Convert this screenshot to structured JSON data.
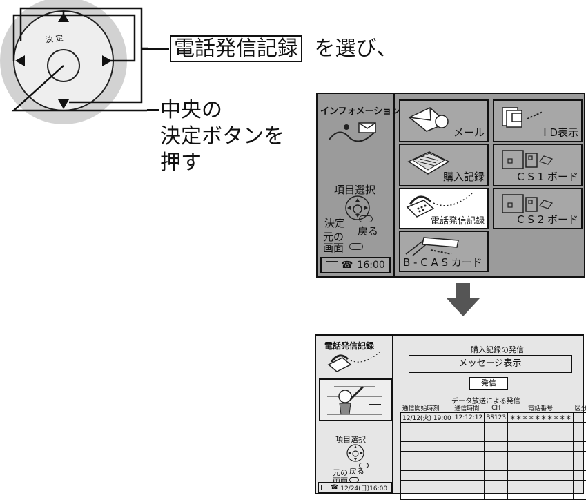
{
  "instruction": {
    "select_item": "電話発信記録",
    "select_suffix": "を選び、",
    "center_line1": "中央の",
    "center_line2": "決定ボタンを",
    "center_line3": "押す",
    "dpad_center_label": "決 定"
  },
  "menu_screen": {
    "title": "インフォメーション",
    "items": [
      {
        "label": "メール",
        "icon": "mail-icon"
      },
      {
        "label": "I D表示",
        "icon": "id-card-icon"
      },
      {
        "label": "購入記録",
        "icon": "purchase-record-icon"
      },
      {
        "label": "C S 1 ボード",
        "icon": "board-icon"
      },
      {
        "label": "電話発信記録",
        "icon": "telephone-icon",
        "selected": true
      },
      {
        "label": "C S 2 ボード",
        "icon": "board-icon"
      },
      {
        "label": "B - C A S カード",
        "icon": "bcas-card-icon"
      }
    ],
    "guide_select": "項目選択",
    "guide_enter": "決定",
    "guide_back": "戻る",
    "guide_prev_line1": "元の",
    "guide_prev_line2": "画面",
    "status_time": "16:00"
  },
  "call_screen": {
    "title": "電話発信記録",
    "purchase_send_title": "購入記録の発信",
    "message_display": "メッセージ表示",
    "send_button": "発信",
    "data_send_title": "データ放送による発信",
    "columns": [
      "通信開始時刻",
      "通信時間",
      "CH",
      "電話番号",
      "区分"
    ],
    "rows": [
      [
        "12/12(火) 19:00",
        "12:12:12",
        "BS123",
        "＊＊＊＊＊＊＊＊＊＊",
        ""
      ]
    ],
    "empty_rows": 8,
    "guide_select": "項目選択",
    "guide_back": "戻る",
    "guide_prev_line1": "元の",
    "guide_prev_line2": "画面",
    "status_datetime": "12/24(日)16:00"
  },
  "colors": {
    "screen_bg": "#9b9b9b",
    "button_bg": "#a7a7a7",
    "selected_bg": "#ffffff",
    "dpad_outer": "#d2d2d2",
    "arrow": "#555555"
  }
}
